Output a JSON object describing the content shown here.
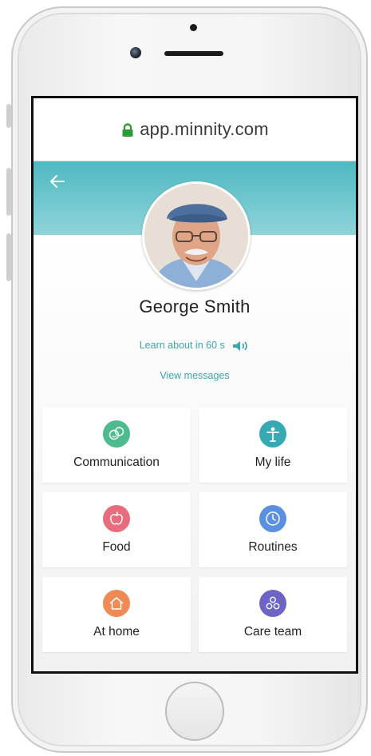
{
  "browser": {
    "url": "app.minnity.com"
  },
  "profile": {
    "name": "George Smith",
    "learn_label": "Learn about in 60 s",
    "view_messages_label": "View messages"
  },
  "tiles": [
    {
      "label": "Communication",
      "icon": "chat-faces-icon",
      "color": "#4dbb8f"
    },
    {
      "label": "My life",
      "icon": "person-icon",
      "color": "#37a9b3"
    },
    {
      "label": "Food",
      "icon": "apple-icon",
      "color": "#e86d7c"
    },
    {
      "label": "Routines",
      "icon": "clock-icon",
      "color": "#5b8fe0"
    },
    {
      "label": "At home",
      "icon": "house-icon",
      "color": "#ef8a55"
    },
    {
      "label": "Care team",
      "icon": "team-icon",
      "color": "#6d64c6"
    }
  ],
  "colors": {
    "accent": "#3aa6ae",
    "banner_top": "#4fb8c1",
    "banner_bottom": "#8fd4da",
    "lock": "#2e9a3a"
  }
}
